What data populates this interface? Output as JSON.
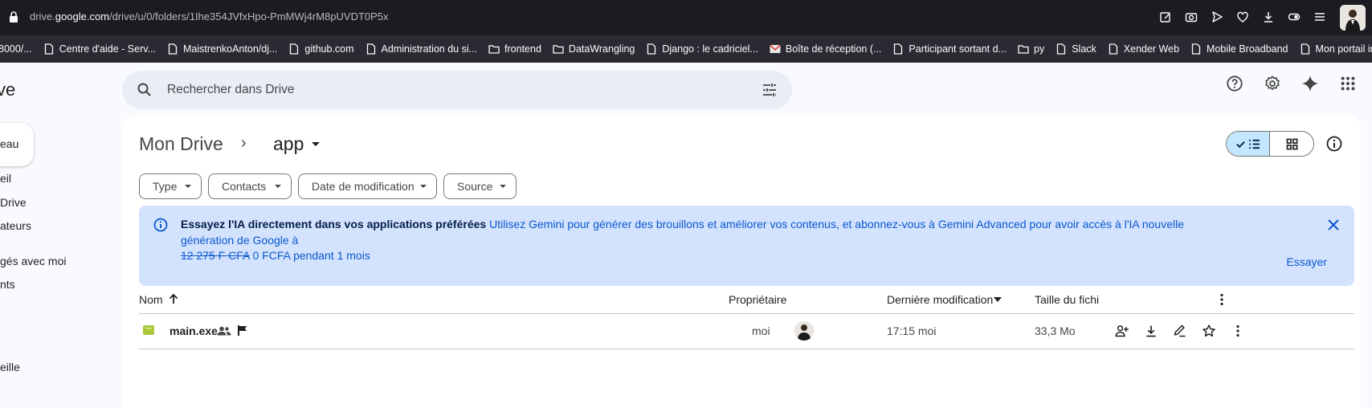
{
  "browser": {
    "url_prefix": "drive.",
    "url_domain": "google.com",
    "url_path": "/drive/u/0/folders/1Ihe354JVfxHpo-PmMWj4rM8pUVDT0P5x",
    "bookmarks": [
      {
        "label": "8000/...",
        "icon": "page-icon"
      },
      {
        "label": "Centre d'aide - Serv...",
        "icon": "page-icon"
      },
      {
        "label": "MaistrenkoAnton/dj...",
        "icon": "page-icon"
      },
      {
        "label": "github.com",
        "icon": "page-icon"
      },
      {
        "label": "Administration du si...",
        "icon": "page-icon"
      },
      {
        "label": "frontend",
        "icon": "folder-icon"
      },
      {
        "label": "DataWrangling",
        "icon": "folder-icon"
      },
      {
        "label": "Django : le cadriciel...",
        "icon": "page-icon"
      },
      {
        "label": "Boîte de réception (...",
        "icon": "mail-icon"
      },
      {
        "label": "Participant sortant d...",
        "icon": "page-icon"
      },
      {
        "label": "py",
        "icon": "folder-icon"
      },
      {
        "label": "Slack",
        "icon": "page-icon"
      },
      {
        "label": "Xender Web",
        "icon": "page-icon"
      },
      {
        "label": "Mobile Broadband",
        "icon": "page-icon"
      },
      {
        "label": "Mon portail internet",
        "icon": "page-icon"
      }
    ]
  },
  "sidebar": {
    "brand": "ve",
    "new_button": "eau",
    "items": [
      {
        "label": "eil"
      },
      {
        "label": "Drive"
      },
      {
        "label": "ateurs"
      },
      {
        "label": "gés avec moi"
      },
      {
        "label": "nts"
      },
      {
        "label": "eille"
      }
    ]
  },
  "search": {
    "placeholder": "Rechercher dans Drive"
  },
  "breadcrumb": {
    "root": "Mon Drive",
    "separator": "›",
    "current": "app"
  },
  "filters": [
    {
      "label": "Type"
    },
    {
      "label": "Contacts"
    },
    {
      "label": "Date de modification"
    },
    {
      "label": "Source"
    }
  ],
  "banner": {
    "title": "Essayez l'IA directement dans vos applications préférées",
    "body": "Utilisez Gemini pour générer des brouillons et améliorer vos contenus, et abonnez-vous à Gemini Advanced pour avoir accès à l'IA nouvelle génération de Google à",
    "old_price": "12 275 F CFA",
    "offer": "0 FCFA pendant 1 mois",
    "action": "Essayer"
  },
  "table": {
    "headers": {
      "name": "Nom",
      "owner": "Propriétaire",
      "modified": "Dernière modification",
      "size": "Taille du fichi"
    },
    "rows": [
      {
        "name": "main.exe",
        "owner": "moi",
        "modified": "17:15 moi",
        "size": "33,3 Mo"
      }
    ]
  },
  "colors": {
    "accent": "#0b57d0",
    "banner_bg": "#d3e3fd",
    "toggle_selected": "#c2e7ff",
    "file_icon": "#a8c73a"
  }
}
